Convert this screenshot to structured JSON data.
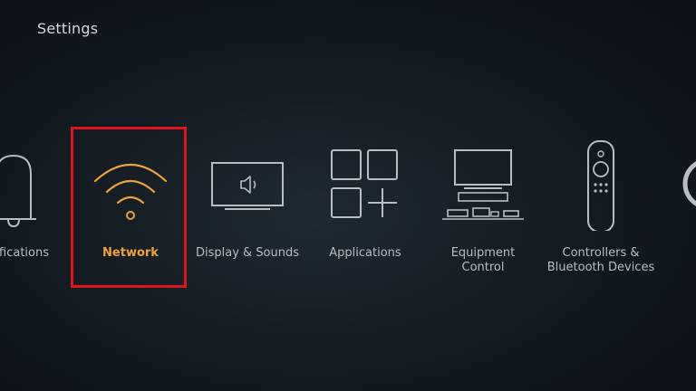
{
  "header": {
    "title": "Settings"
  },
  "menu": {
    "items": [
      {
        "label": "ifications",
        "icon": "bell-icon"
      },
      {
        "label": "Network",
        "icon": "wifi-icon",
        "selected": true
      },
      {
        "label": "Display & Sounds",
        "icon": "tv-speaker-icon"
      },
      {
        "label": "Applications",
        "icon": "apps-grid-icon"
      },
      {
        "label_line1": "Equipment",
        "label_line2": "Control",
        "icon": "equipment-icon"
      },
      {
        "label_line1": "Controllers &",
        "label_line2": "Bluetooth Devices",
        "icon": "remote-control-icon"
      },
      {
        "icon": "partial-circle-icon"
      }
    ]
  },
  "colors": {
    "accent": "#f0a23a",
    "selection_border": "#e0141b",
    "icon_stroke": "#b8bec4",
    "background": "#141b22"
  }
}
